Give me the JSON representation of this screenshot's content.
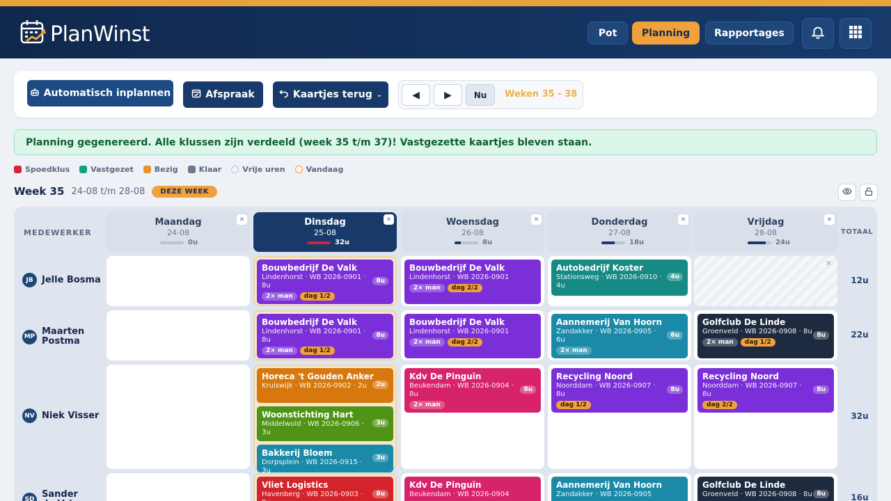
{
  "app": {
    "name": "PlanWinst",
    "nav": [
      "Pot",
      "Planning",
      "Rapportages"
    ],
    "active_nav": "Planning",
    "icons": [
      "bell-icon",
      "apps-grid-icon"
    ]
  },
  "toolbar": {
    "auto_label": "Automatisch inplannen",
    "afspraak_label": "Afspraak",
    "kaartjes_label": "Kaartjes terug",
    "prev": "◀",
    "next": "▶",
    "now_label": "Nu",
    "weeks_label": "Weken 35 - 38"
  },
  "alert": "Planning gegenereerd. Alle klussen zijn verdeeld (week 35 t/m 37)! Vastgezette kaartjes bleven staan.",
  "legend": [
    {
      "label": "Spoedklus",
      "color": "#d6223c"
    },
    {
      "label": "Vastgezet",
      "color": "#12a37a"
    },
    {
      "label": "Bezig",
      "color": "#e8902a"
    },
    {
      "label": "Klaar",
      "color": "#6b7a90"
    },
    {
      "label": "Vrije uren",
      "color": "dashed"
    },
    {
      "label": "Vandaag",
      "color": "today"
    }
  ],
  "week": {
    "title": "Week 35",
    "range": "24-08 t/m 28-08",
    "badge": "DEZE WEEK"
  },
  "table": {
    "col_employee": "MEDEWERKER",
    "col_total": "TOTAAL",
    "days": [
      {
        "name": "Maandag",
        "date": "24-08",
        "hours": "0u",
        "load": 0,
        "today": false
      },
      {
        "name": "Dinsdag",
        "date": "25-08",
        "hours": "32u",
        "load": 1.0,
        "today": true
      },
      {
        "name": "Woensdag",
        "date": "26-08",
        "hours": "8u",
        "load": 0.25,
        "today": false
      },
      {
        "name": "Donderdag",
        "date": "27-08",
        "hours": "18u",
        "load": 0.56,
        "today": false
      },
      {
        "name": "Vrijdag",
        "date": "28-08",
        "hours": "24u",
        "load": 0.75,
        "today": false
      }
    ],
    "employees": [
      {
        "initials": "JB",
        "name": "Jelle Bosma",
        "total": "12u"
      },
      {
        "initials": "MP",
        "name": "Maarten Postma",
        "total": "22u"
      },
      {
        "initials": "NV",
        "name": "Niek Visser",
        "total": "32u"
      },
      {
        "initials": "SD",
        "name": "Sander de Vries",
        "total": "16u"
      }
    ],
    "cards": [
      {
        "row": 0,
        "day": 1,
        "title": "Bouwbedrijf De Valk",
        "sub": "Lindenhorst · WB 2026-0901 · 8u",
        "hours": "8u",
        "chips": [
          "2× man",
          "dag 1/2"
        ],
        "color": "purple"
      },
      {
        "row": 0,
        "day": 2,
        "title": "Bouwbedrijf De Valk",
        "sub": "Lindenhorst · WB 2026-0901",
        "hours": "",
        "chips": [
          "2× man",
          "dag 2/2"
        ],
        "color": "purple"
      },
      {
        "row": 0,
        "day": 3,
        "title": "Autobedrijf Koster",
        "sub": "Stationsweg · WB 2026-0910 · 4u",
        "hours": "4u",
        "chips": [],
        "color": "teal"
      },
      {
        "row": 1,
        "day": 1,
        "title": "Bouwbedrijf De Valk",
        "sub": "Lindenhorst · WB 2026-0901 · 8u",
        "hours": "8u",
        "chips": [
          "2× man",
          "dag 1/2"
        ],
        "color": "purple"
      },
      {
        "row": 1,
        "day": 2,
        "title": "Bouwbedrijf De Valk",
        "sub": "Lindenhorst · WB 2026-0901",
        "hours": "",
        "chips": [
          "2× man",
          "dag 2/2"
        ],
        "color": "purple"
      },
      {
        "row": 1,
        "day": 3,
        "title": "Aannemerij Van Hoorn",
        "sub": "Zandakker · WB 2026-0905 · 6u",
        "hours": "6u",
        "chips": [
          "2× man"
        ],
        "color": "cyan"
      },
      {
        "row": 1,
        "day": 4,
        "title": "Golfclub De Linde",
        "sub": "Groenveld · WB 2026-0908 · 8u",
        "hours": "8u",
        "chips": [
          "2× man",
          "dag 1/2"
        ],
        "color": "dark"
      },
      {
        "row": 2,
        "day": 1,
        "title": "Horeca 't Gouden Anker",
        "sub": "Kruiswijk · WB 2026-0902 · 2u",
        "hours": "2u",
        "chips": [],
        "color": "orange"
      },
      {
        "row": 2,
        "day": 1,
        "title": "Woonstichting Hart",
        "sub": "Middelwold · WB 2026-0906 · 3u",
        "hours": "3u",
        "chips": [],
        "color": "green"
      },
      {
        "row": 2,
        "day": 1,
        "title": "Bakkerij Bloem",
        "sub": "Dorpsplein · WB 2026-0915 · 3u",
        "hours": "3u",
        "chips": [],
        "color": "cyan"
      },
      {
        "row": 2,
        "day": 2,
        "title": "Kdv De Pinguïn",
        "sub": "Beukendam · WB 2026-0904 · 8u",
        "hours": "8u",
        "chips": [
          "2× man"
        ],
        "color": "magenta"
      },
      {
        "row": 2,
        "day": 3,
        "title": "Recycling Noord",
        "sub": "Noorddam · WB 2026-0907 · 8u",
        "hours": "8u",
        "chips": [
          "dag 1/2"
        ],
        "color": "purple"
      },
      {
        "row": 2,
        "day": 4,
        "title": "Recycling Noord",
        "sub": "Noorddam · WB 2026-0907 · 8u",
        "hours": "8u",
        "chips": [
          "dag 2/2"
        ],
        "color": "purple"
      },
      {
        "row": 3,
        "day": 1,
        "title": "Vliet Logistics",
        "sub": "Havenberg · WB 2026-0903 · 8u",
        "hours": "8u",
        "chips": [],
        "color": "red"
      },
      {
        "row": 3,
        "day": 2,
        "title": "Kdv De Pinguïn",
        "sub": "Beukendam · WB 2026-0904",
        "hours": "",
        "chips": [],
        "color": "magenta"
      },
      {
        "row": 3,
        "day": 3,
        "title": "Aannemerij Van Hoorn",
        "sub": "Zandakker · WB 2026-0905",
        "hours": "",
        "chips": [],
        "color": "cyan"
      },
      {
        "row": 3,
        "day": 4,
        "title": "Golfclub De Linde",
        "sub": "Groenveld · WB 2026-0908 · 8u",
        "hours": "8u",
        "chips": [],
        "color": "dark"
      }
    ],
    "free_slot": {
      "row": 0,
      "day": 4
    }
  }
}
